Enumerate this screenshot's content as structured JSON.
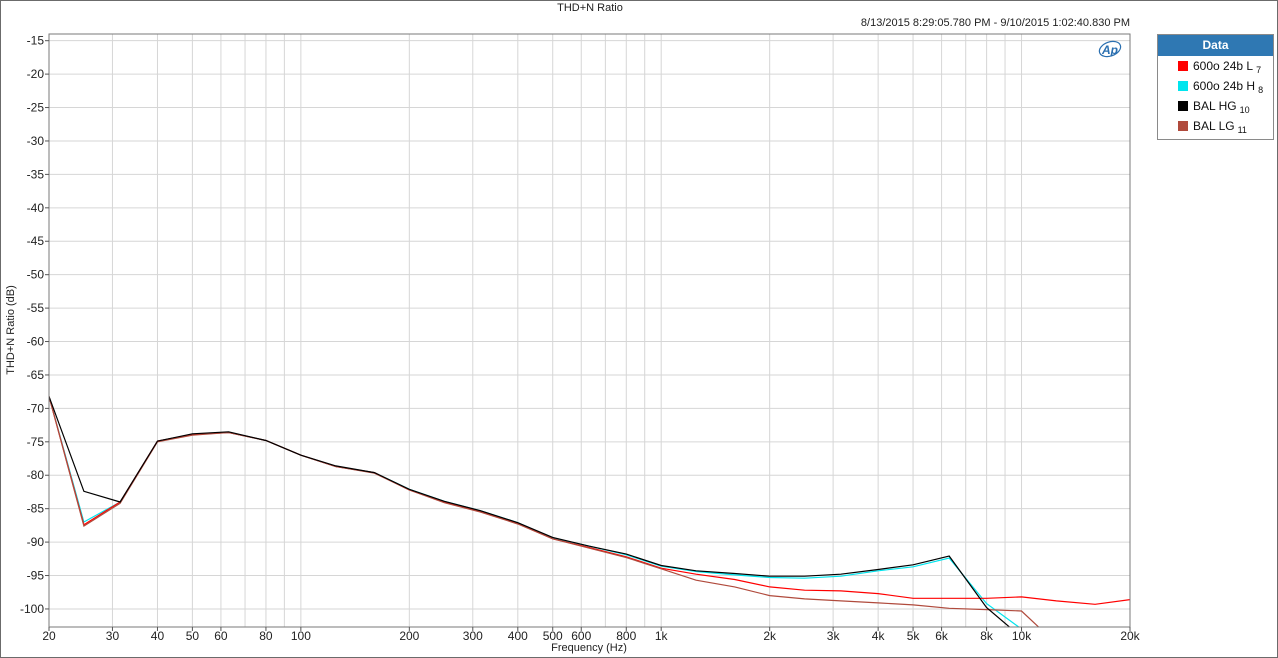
{
  "chart_data": {
    "type": "line",
    "title": "THD+N Ratio",
    "timestamp": "8/13/2015 8:29:05.780 PM - 9/10/2015 1:02:40.830 PM",
    "xlabel": "Frequency (Hz)",
    "ylabel": "THD+N Ratio (dB)",
    "xscale": "log",
    "xlim": [
      20,
      20000
    ],
    "ylim": [
      -102.7,
      -14
    ],
    "grid": true,
    "legend_position": "right",
    "legend_title": "Data",
    "x_tick_values": [
      20,
      30,
      40,
      50,
      60,
      80,
      100,
      200,
      300,
      400,
      500,
      600,
      800,
      1000,
      2000,
      3000,
      4000,
      5000,
      6000,
      8000,
      10000,
      20000
    ],
    "x_tick_labels": [
      "20",
      "30",
      "40",
      "50",
      "60",
      "80",
      "100",
      "200",
      "300",
      "400",
      "500",
      "600",
      "800",
      "1k",
      "2k",
      "3k",
      "4k",
      "5k",
      "6k",
      "8k",
      "10k",
      "20k"
    ],
    "y_tick_values": [
      -15,
      -20,
      -25,
      -30,
      -35,
      -40,
      -45,
      -50,
      -55,
      -60,
      -65,
      -70,
      -75,
      -80,
      -85,
      -90,
      -95,
      -100
    ],
    "y_tick_labels": [
      "-15",
      "-20",
      "-25",
      "-30",
      "-35",
      "-40",
      "-45",
      "-50",
      "-55",
      "-60",
      "-65",
      "-70",
      "-75",
      "-80",
      "-85",
      "-90",
      "-95",
      "-100"
    ],
    "series": [
      {
        "name": "600o 24b L",
        "sub": "7",
        "color": "#ff0000",
        "x": [
          20,
          25,
          31.5,
          40,
          50,
          63,
          80,
          100,
          125,
          160,
          200,
          250,
          315,
          400,
          500,
          630,
          800,
          1000,
          1250,
          1600,
          2000,
          2500,
          3150,
          4000,
          5000,
          6300,
          8000,
          10000,
          12500,
          16000,
          20000
        ],
        "y": [
          -68.2,
          -87.4,
          -84.0,
          -74.9,
          -73.9,
          -73.6,
          -74.8,
          -77.0,
          -78.7,
          -79.6,
          -82.2,
          -84.0,
          -85.4,
          -87.2,
          -89.5,
          -90.8,
          -92.2,
          -93.9,
          -94.8,
          -95.6,
          -96.7,
          -97.2,
          -97.3,
          -97.7,
          -98.4,
          -98.4,
          -98.4,
          -98.2,
          -98.8,
          -99.3,
          -98.6
        ]
      },
      {
        "name": "600o 24b H",
        "sub": "8",
        "color": "#00e5ee",
        "x": [
          20,
          25,
          31.5,
          40,
          50,
          63,
          80,
          100,
          125,
          160,
          200,
          250,
          315,
          400,
          500,
          630,
          800,
          1000,
          1250,
          1600,
          2000,
          2500,
          3150,
          4000,
          5000,
          6300,
          8000,
          10000
        ],
        "y": [
          -68.2,
          -87.0,
          -84.0,
          -74.9,
          -73.9,
          -73.6,
          -74.8,
          -77.0,
          -78.7,
          -79.6,
          -82.1,
          -83.9,
          -85.3,
          -87.1,
          -89.4,
          -90.6,
          -91.9,
          -93.6,
          -94.4,
          -94.9,
          -95.3,
          -95.4,
          -95.1,
          -94.3,
          -93.7,
          -92.4,
          -99.2,
          -103.0
        ]
      },
      {
        "name": "BAL HG",
        "sub": "10",
        "color": "#000000",
        "x": [
          20,
          25,
          31.5,
          40,
          50,
          63,
          80,
          100,
          125,
          160,
          200,
          250,
          315,
          400,
          500,
          630,
          800,
          1000,
          1250,
          1600,
          2000,
          2500,
          3150,
          4000,
          5000,
          6300,
          8000,
          9400
        ],
        "y": [
          -68.2,
          -82.4,
          -84.0,
          -74.9,
          -73.8,
          -73.5,
          -74.8,
          -77.0,
          -78.6,
          -79.6,
          -82.1,
          -83.9,
          -85.3,
          -87.1,
          -89.3,
          -90.6,
          -91.8,
          -93.5,
          -94.3,
          -94.7,
          -95.1,
          -95.1,
          -94.8,
          -94.1,
          -93.4,
          -92.1,
          -99.8,
          -103.0
        ]
      },
      {
        "name": "BAL LG",
        "sub": "11",
        "color": "#b04a3c",
        "x": [
          20,
          25,
          31.5,
          40,
          50,
          63,
          80,
          100,
          125,
          160,
          200,
          250,
          315,
          400,
          500,
          630,
          800,
          1000,
          1250,
          1600,
          2000,
          2500,
          3150,
          4000,
          5000,
          6300,
          8000,
          10000,
          11300
        ],
        "y": [
          -68.2,
          -87.6,
          -84.2,
          -75.0,
          -74.0,
          -73.6,
          -74.8,
          -77.0,
          -78.7,
          -79.7,
          -82.2,
          -84.1,
          -85.5,
          -87.3,
          -89.5,
          -90.9,
          -92.3,
          -94.0,
          -95.7,
          -96.7,
          -98.0,
          -98.5,
          -98.8,
          -99.1,
          -99.4,
          -99.9,
          -100.1,
          -100.3,
          -103.0
        ]
      }
    ]
  },
  "colors": {
    "legend_header": "#2f78b3",
    "grid": "#d6d6d6",
    "plot_border": "#7a7a7a"
  },
  "logo": {
    "text": "Ap"
  }
}
